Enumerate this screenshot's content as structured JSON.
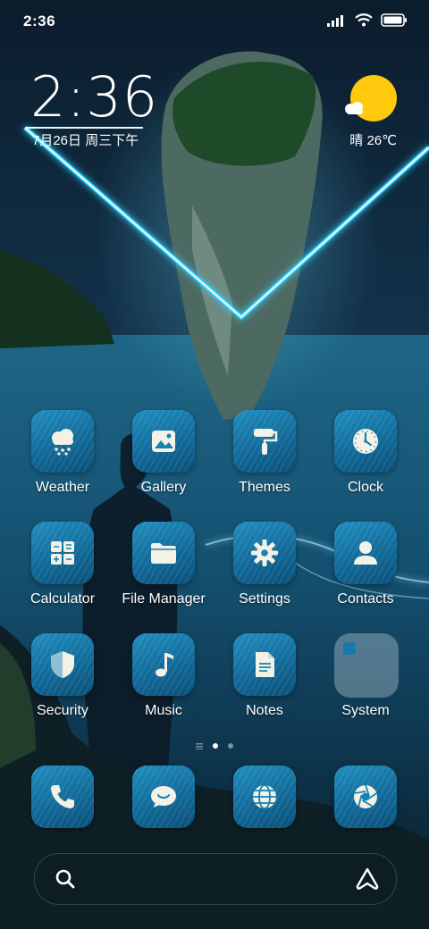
{
  "status_bar": {
    "time": "2:36",
    "icons": [
      "signal-icon",
      "wifi-icon",
      "battery-icon"
    ]
  },
  "clock_widget": {
    "time": "2:36",
    "date": "7月26日 周三下午",
    "weather": "晴 26℃",
    "weather_icon": "sunny-cloud-icon"
  },
  "apps": [
    {
      "label": "Weather",
      "icon": "cloud-rain-icon"
    },
    {
      "label": "Gallery",
      "icon": "image-icon"
    },
    {
      "label": "Themes",
      "icon": "paint-roller-icon"
    },
    {
      "label": "Clock",
      "icon": "clock-icon"
    },
    {
      "label": "Calculator",
      "icon": "calculator-icon"
    },
    {
      "label": "File Manager",
      "icon": "folder-icon"
    },
    {
      "label": "Settings",
      "icon": "gear-icon"
    },
    {
      "label": "Contacts",
      "icon": "person-icon"
    },
    {
      "label": "Security",
      "icon": "shield-icon"
    },
    {
      "label": "Music",
      "icon": "music-note-icon"
    },
    {
      "label": "Notes",
      "icon": "note-icon"
    },
    {
      "label": "System",
      "icon": "folder-group-icon"
    }
  ],
  "dock": [
    {
      "icon": "phone-icon"
    },
    {
      "icon": "message-icon"
    },
    {
      "icon": "globe-icon"
    },
    {
      "icon": "camera-shutter-icon"
    }
  ],
  "pager": {
    "pages": 2,
    "current": 1
  },
  "search_bar": {
    "left_icon": "search-icon",
    "right_icon": "assistant-icon"
  },
  "colors": {
    "icon_bg": "#1483b5",
    "neon": "#39d4ff",
    "sun": "#ffc90e"
  }
}
